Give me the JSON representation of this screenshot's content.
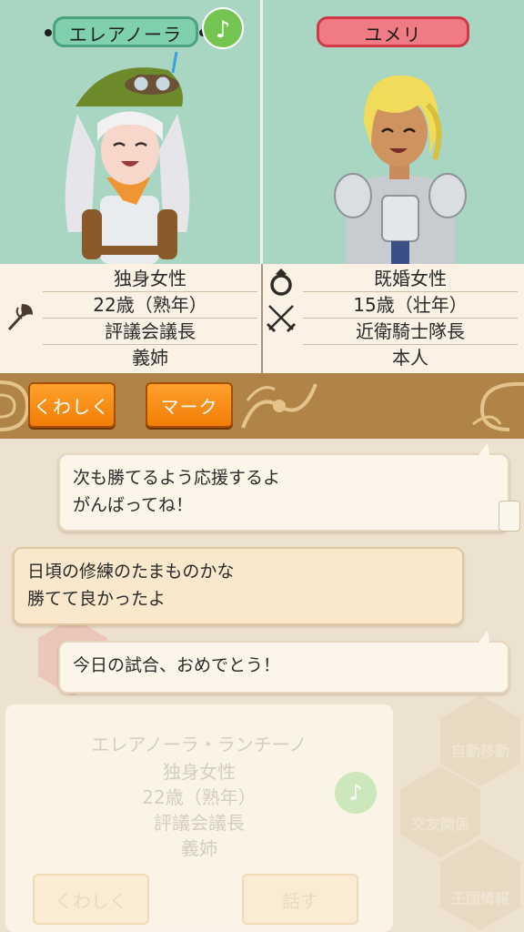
{
  "characters": {
    "left": {
      "name": "エレアノーラ",
      "music_badge": "♪",
      "info": [
        "独身女性",
        "22歳（熟年）",
        "評議会議長",
        "義姉"
      ],
      "icon": "axe-icon"
    },
    "right": {
      "name": "ユメリ",
      "info": [
        "既婚女性",
        "15歳（壮年）",
        "近衛騎士隊長",
        "本人"
      ],
      "icons": [
        "ring-icon",
        "crossed-swords-icon"
      ]
    }
  },
  "buttons": {
    "detail_label": "くわしく",
    "mark_label": "マーク"
  },
  "chat": {
    "messages": [
      {
        "side": "right",
        "lines": [
          "次も勝てるよう応援するよ",
          "がんばってね！"
        ]
      },
      {
        "side": "left",
        "lines": [
          "日頃の修練のたまものかな",
          "勝てて良かったよ"
        ]
      },
      {
        "side": "right",
        "lines": [
          "今日の試合、おめでとう！"
        ]
      }
    ]
  },
  "background_panel": {
    "full_name": "エレアノーラ・ランチーノ",
    "info": [
      "独身女性",
      "22歳（熟年）",
      "評議会議長",
      "義姉"
    ],
    "detail_label": "くわしく",
    "talk_label": "話す",
    "music_badge": "♪",
    "hex_buttons": [
      "自動移動",
      "交友関係",
      "王国情報"
    ]
  },
  "colors": {
    "portrait_bg": "#a9d6c3",
    "name_left": "#7fd1ad",
    "name_right": "#f07b84",
    "button_orange": "#f28a12",
    "bar_brown": "#b08347"
  }
}
